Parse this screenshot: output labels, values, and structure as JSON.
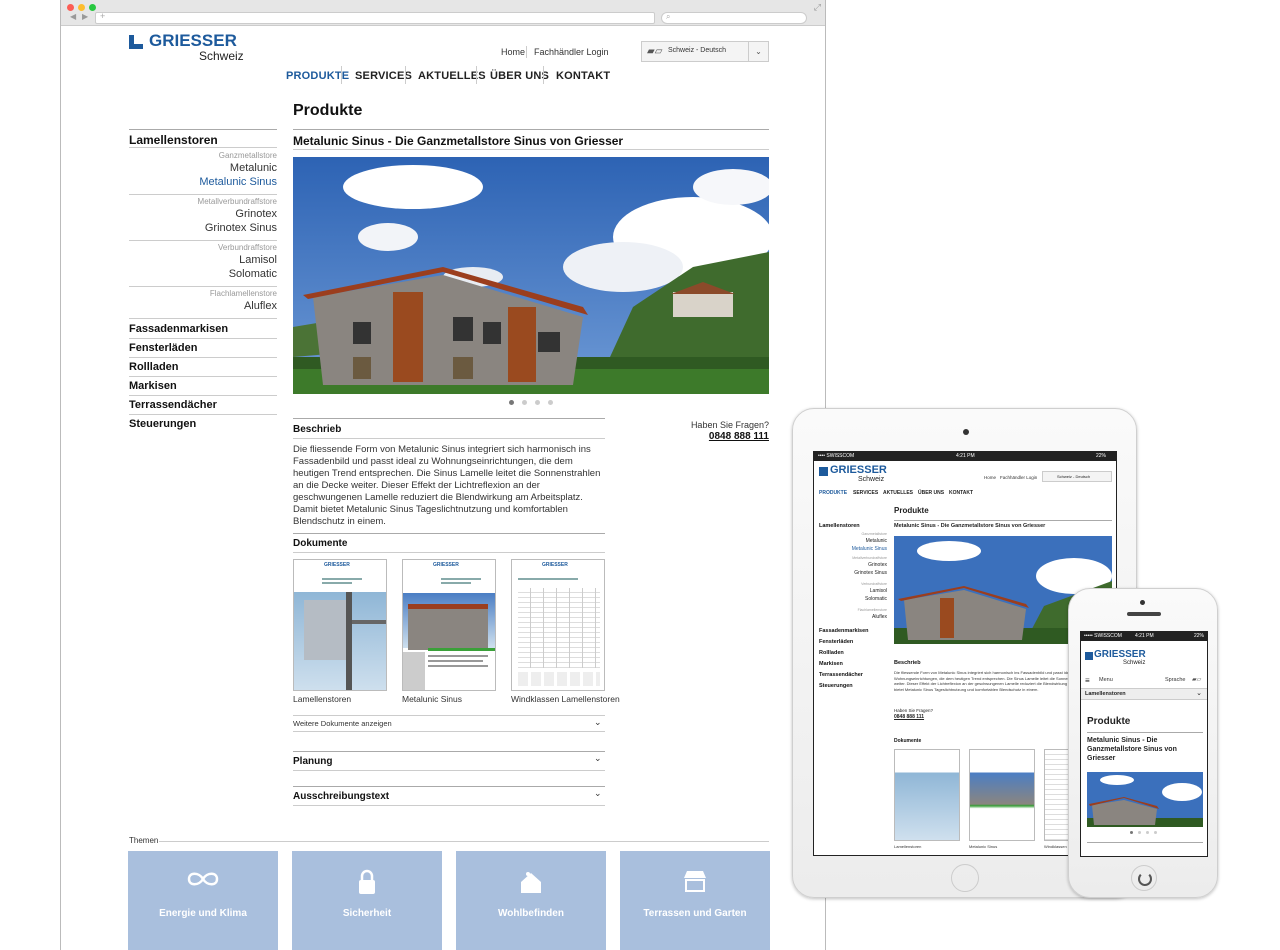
{
  "colors": {
    "brand": "#1d5a9c",
    "tile": "#a9bfdd",
    "sky": "#3f74bf"
  },
  "site": {
    "logo": {
      "name": "GRIESSER",
      "sub": "Schweiz"
    },
    "topnav": {
      "home": "Home",
      "login": "Fachhändler Login"
    },
    "lang": {
      "label": "Schweiz - Deutsch"
    },
    "mainnav": [
      "PRODUKTE",
      "SERVICES",
      "AKTUELLES",
      "ÜBER UNS",
      "KONTAKT"
    ],
    "page_title": "Produkte",
    "product_title": "Metalunic Sinus - Die Ganzmetallstore Sinus von Griesser",
    "sidebar": {
      "head": "Lamellenstoren",
      "groups": [
        {
          "label": "Ganzmetallstore",
          "items": [
            "Metalunic",
            "Metalunic Sinus"
          ]
        },
        {
          "label": "Metallverbundraffstore",
          "items": [
            "Grinotex",
            "Grinotex Sinus"
          ]
        },
        {
          "label": "Verbundraffstore",
          "items": [
            "Lamisol",
            "Solomatic"
          ]
        },
        {
          "label": "Flachlamellenstore",
          "items": [
            "Aluflex"
          ]
        }
      ],
      "categories": [
        "Fassadenmarkisen",
        "Fensterläden",
        "Rollladen",
        "Markisen",
        "Terrassendächer",
        "Steuerungen"
      ]
    },
    "contact": {
      "question": "Haben Sie Fragen?",
      "phone": "0848 888 111"
    },
    "beschrieb": {
      "title": "Beschrieb",
      "text": "Die fliessende Form von Metalunic Sinus integriert sich harmonisch ins Fassadenbild und passt ideal zu Wohnungseinrichtungen, die dem heutigen Trend entsprechen. Die Sinus Lamelle leitet die Sonnenstrahlen an die Decke weiter. Dieser Effekt der Lichtreflexion an der geschwungenen Lamelle reduziert die Blendwirkung am Arbeitsplatz. Damit bietet Metalunic Sinus Tageslichtnutzung und komfortablen Blendschutz in einem."
    },
    "dokumente": {
      "title": "Dokumente",
      "items": [
        "Lamellenstoren",
        "Metalunic Sinus",
        "Windklassen Lamellenstoren"
      ],
      "more": "Weitere Dokumente anzeigen",
      "doc_logo": "GRIESSER"
    },
    "accordion": [
      "Planung",
      "Ausschreibungstext"
    ],
    "themen": {
      "title": "Themen",
      "tiles": [
        "Energie und Klima",
        "Sicherheit",
        "Wohlbefinden",
        "Terrassen und Garten"
      ]
    }
  },
  "tablet": {
    "status": {
      "carrier": "•••• SWISSCOM",
      "time": "4:21 PM",
      "battery": "22%"
    },
    "sidebar": [
      "Lamellenstoren",
      "Ganzmetallstore",
      "Metalunic",
      "Metalunic Sinus",
      "Metallverbundraffstore",
      "Grinotex",
      "Grinotex Sinus",
      "Verbundraffstore",
      "Lamisol",
      "Solomatic",
      "Flachlamellenstore",
      "Aluflex"
    ],
    "categories": [
      "Fassadenmarkisen",
      "Fensterläden",
      "Rollladen",
      "Markisen",
      "Terrassendächer",
      "Steuerungen"
    ],
    "docs": [
      "Lamellenstoren",
      "Metalunic Sinus",
      "Windklassen Lamellens"
    ]
  },
  "phone": {
    "status": {
      "carrier": "••••• SWISSCOM",
      "time": "4:21 PM",
      "battery": "22%"
    },
    "menu": "Menu",
    "sprache": "Sprache",
    "dropdown": "Lamellenstoren",
    "title": "Produkte",
    "product_title": "Metalunic Sinus - Die Ganzmetallstore Sinus von Griesser"
  }
}
